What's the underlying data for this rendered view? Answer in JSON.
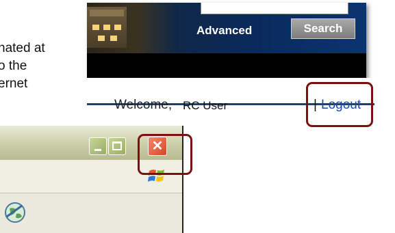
{
  "intro_text": {
    "line1": "nated at",
    "line2": "o the",
    "line3": "ernet"
  },
  "site_header": {
    "search_placeholder": "",
    "advanced_label": "Advanced",
    "search_button_label": "Search"
  },
  "user_bar": {
    "welcome_label": "Welcome,",
    "username": "RC User",
    "separator": "|",
    "logout_label": "Logout"
  },
  "browser_window": {
    "minimize_glyph": "",
    "maximize_glyph": "",
    "close_glyph": "✕"
  },
  "icons": [
    "windows-logo-icon",
    "globe-icon"
  ],
  "colors": {
    "highlight": "#7a1010",
    "banner_blue": "#0a2a5c",
    "logout_link": "#1a4aa8",
    "close_button": "#d9452a"
  }
}
